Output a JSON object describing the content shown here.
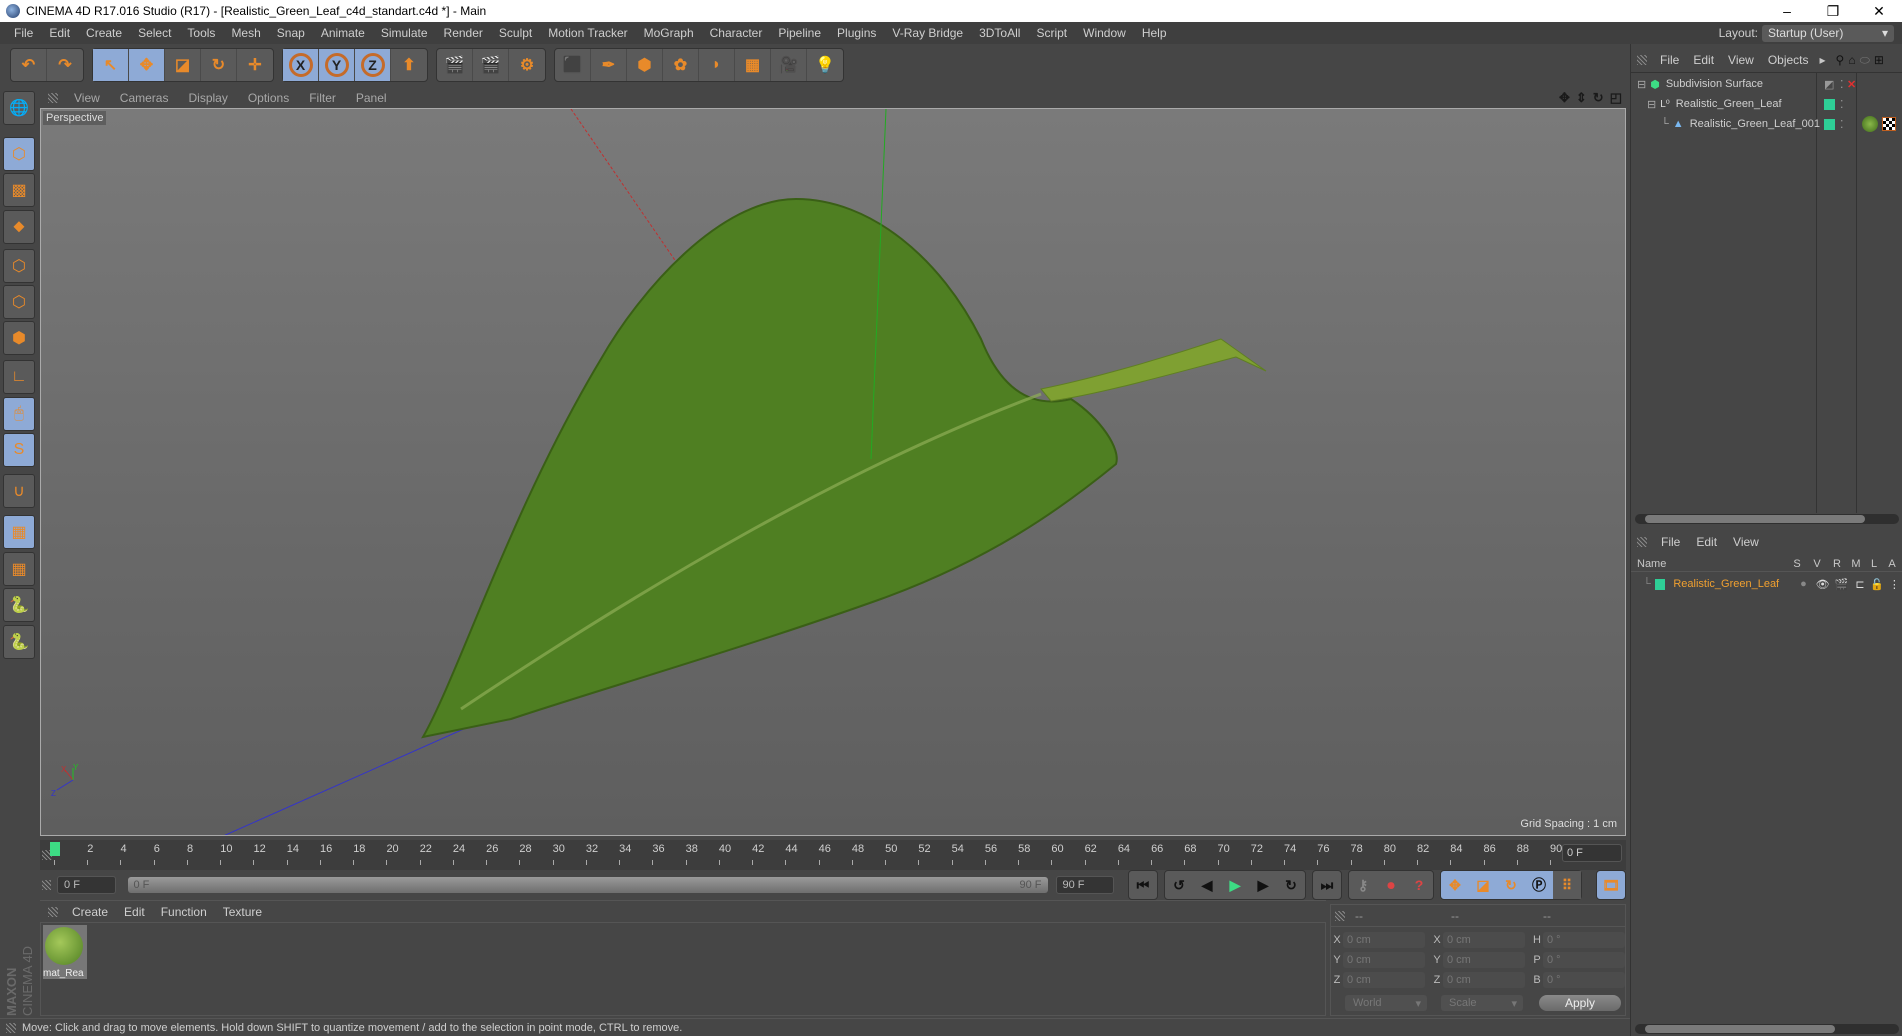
{
  "window": {
    "title": "CINEMA 4D R17.016 Studio (R17) - [Realistic_Green_Leaf_c4d_standart.c4d *] - Main",
    "controls": [
      "–",
      "❐",
      "✕"
    ]
  },
  "menubar": {
    "items": [
      "File",
      "Edit",
      "Create",
      "Select",
      "Tools",
      "Mesh",
      "Snap",
      "Animate",
      "Simulate",
      "Render",
      "Sculpt",
      "Motion Tracker",
      "MoGraph",
      "Character",
      "Pipeline",
      "Plugins",
      "V-Ray Bridge",
      "3DToAll",
      "Script",
      "Window",
      "Help"
    ],
    "layout_label": "Layout:",
    "layout_value": "Startup (User)"
  },
  "toolbar": {
    "groups": [
      [
        {
          "icon": "undo-icon",
          "glyph": "↶"
        },
        {
          "icon": "redo-icon",
          "glyph": "↷"
        }
      ],
      [
        {
          "icon": "live-selection-icon",
          "glyph": "↖",
          "on": true
        },
        {
          "icon": "move-icon",
          "glyph": "✥",
          "on": true
        },
        {
          "icon": "scale-icon",
          "glyph": "◪"
        },
        {
          "icon": "rotate-icon",
          "glyph": "↻"
        },
        {
          "icon": "move-alt-icon",
          "glyph": "✛"
        }
      ],
      [
        {
          "icon": "x-axis-icon",
          "glyph": "X",
          "on": true
        },
        {
          "icon": "y-axis-icon",
          "glyph": "Y",
          "on": true
        },
        {
          "icon": "z-axis-icon",
          "glyph": "Z",
          "on": true
        },
        {
          "icon": "coordinate-system-icon",
          "glyph": "⬆"
        }
      ],
      [
        {
          "icon": "render-view-icon",
          "glyph": "🎬"
        },
        {
          "icon": "render-picture-viewer-icon",
          "glyph": "🎬"
        },
        {
          "icon": "render-settings-icon",
          "glyph": "⚙"
        }
      ],
      [
        {
          "icon": "cube-icon",
          "glyph": "⬛"
        },
        {
          "icon": "pen-spline-icon",
          "glyph": "✒"
        },
        {
          "icon": "subdivision-surface-icon",
          "glyph": "⬢"
        },
        {
          "icon": "cloner-icon",
          "glyph": "✿"
        },
        {
          "icon": "deformer-icon",
          "glyph": "◗"
        },
        {
          "icon": "floor-icon",
          "glyph": "▦"
        },
        {
          "icon": "camera-icon",
          "glyph": "🎥"
        },
        {
          "icon": "light-icon",
          "glyph": "💡"
        }
      ]
    ]
  },
  "left_tools": [
    {
      "icon": "make-editable-icon",
      "glyph": "🌐"
    },
    {
      "icon": "model-mode-icon",
      "glyph": "⬡",
      "on": true
    },
    {
      "icon": "texture-mode-icon",
      "glyph": "▩"
    },
    {
      "icon": "workplane-mode-icon",
      "glyph": "⬥"
    },
    {
      "icon": "points-mode-icon",
      "glyph": "⬡"
    },
    {
      "icon": "edges-mode-icon",
      "glyph": "⬡"
    },
    {
      "icon": "polygons-mode-icon",
      "glyph": "⬢"
    },
    {
      "icon": "axis-mode-icon",
      "glyph": "∟"
    },
    {
      "icon": "tweak-mode-icon",
      "glyph": "🖱",
      "on": true
    },
    {
      "icon": "snap-icon",
      "glyph": "S",
      "on": true
    },
    {
      "icon": "magnet-icon",
      "glyph": "∪"
    },
    {
      "icon": "locked-workplane-icon",
      "glyph": "▦",
      "on": true
    },
    {
      "icon": "planar-workplane-icon",
      "glyph": "▦"
    },
    {
      "icon": "python-icon",
      "glyph": "🐍"
    },
    {
      "icon": "python-2-icon",
      "glyph": "🐍"
    }
  ],
  "viewport": {
    "menu": [
      "View",
      "Cameras",
      "Display",
      "Options",
      "Filter",
      "Panel"
    ],
    "label": "Perspective",
    "grid_spacing": "Grid Spacing : 1 cm",
    "nav_icons": [
      "move-view-icon",
      "zoom-view-icon",
      "rotate-view-icon",
      "maximize-view-icon"
    ],
    "axis_labels": {
      "x": "X",
      "y": "Y",
      "z": "Z"
    }
  },
  "timeline": {
    "ticks": [
      0,
      2,
      4,
      6,
      8,
      10,
      12,
      14,
      16,
      18,
      20,
      22,
      24,
      26,
      28,
      30,
      32,
      34,
      36,
      38,
      40,
      42,
      44,
      46,
      48,
      50,
      52,
      54,
      56,
      58,
      60,
      62,
      64,
      66,
      68,
      70,
      72,
      74,
      76,
      78,
      80,
      82,
      84,
      86,
      88,
      90
    ],
    "current_frame": "0 F",
    "start_field": "0 F",
    "range_start": "0 F",
    "range_end": "90 F",
    "end_field": "90 F"
  },
  "playback": {
    "buttons": [
      "go-to-start",
      "go-to-previous-key",
      "play-backwards",
      "play-forwards",
      "go-to-next-key",
      "go-to-end"
    ]
  },
  "material_manager": {
    "menu": [
      "Create",
      "Edit",
      "Function",
      "Texture"
    ],
    "materials": [
      {
        "name": "mat_Rea"
      }
    ]
  },
  "coordinates": {
    "headers": [
      "--",
      "--",
      "--"
    ],
    "rows": [
      {
        "a": "X",
        "av": "0 cm",
        "b": "X",
        "bv": "0 cm",
        "c": "H",
        "cv": "0 °"
      },
      {
        "a": "Y",
        "av": "0 cm",
        "b": "Y",
        "bv": "0 cm",
        "c": "P",
        "cv": "0 °"
      },
      {
        "a": "Z",
        "av": "0 cm",
        "b": "Z",
        "bv": "0 cm",
        "c": "B",
        "cv": "0 °"
      }
    ],
    "mode": "World",
    "type": "Scale",
    "apply": "Apply"
  },
  "object_manager": {
    "menu": [
      "File",
      "Edit",
      "View",
      "Objects"
    ],
    "objects": [
      {
        "name": "Subdivision Surface",
        "indent": 0,
        "icon": "subdivision-surface-icon"
      },
      {
        "name": "Realistic_Green_Leaf",
        "indent": 1,
        "icon": "null-object-icon"
      },
      {
        "name": "Realistic_Green_Leaf_001",
        "indent": 2,
        "icon": "polygon-object-icon"
      }
    ]
  },
  "layer_manager": {
    "menu": [
      "File",
      "Edit",
      "View"
    ],
    "columns": [
      "Name",
      "S",
      "V",
      "R",
      "M",
      "L",
      "A"
    ],
    "layers": [
      {
        "name": "Realistic_Green_Leaf",
        "color": "#2ecf96"
      }
    ]
  },
  "status": "Move: Click and drag to move elements. Hold down SHIFT to quantize movement / add to the selection in point mode, CTRL to remove.",
  "brand": {
    "maxon": "MAXON",
    "cinema": "CINEMA 4D"
  },
  "colors": {
    "accent_blue": "#8eaad6",
    "layer_green": "#2ecf96",
    "layer_name": "#f0a030",
    "leaf": "#4f7f22"
  }
}
